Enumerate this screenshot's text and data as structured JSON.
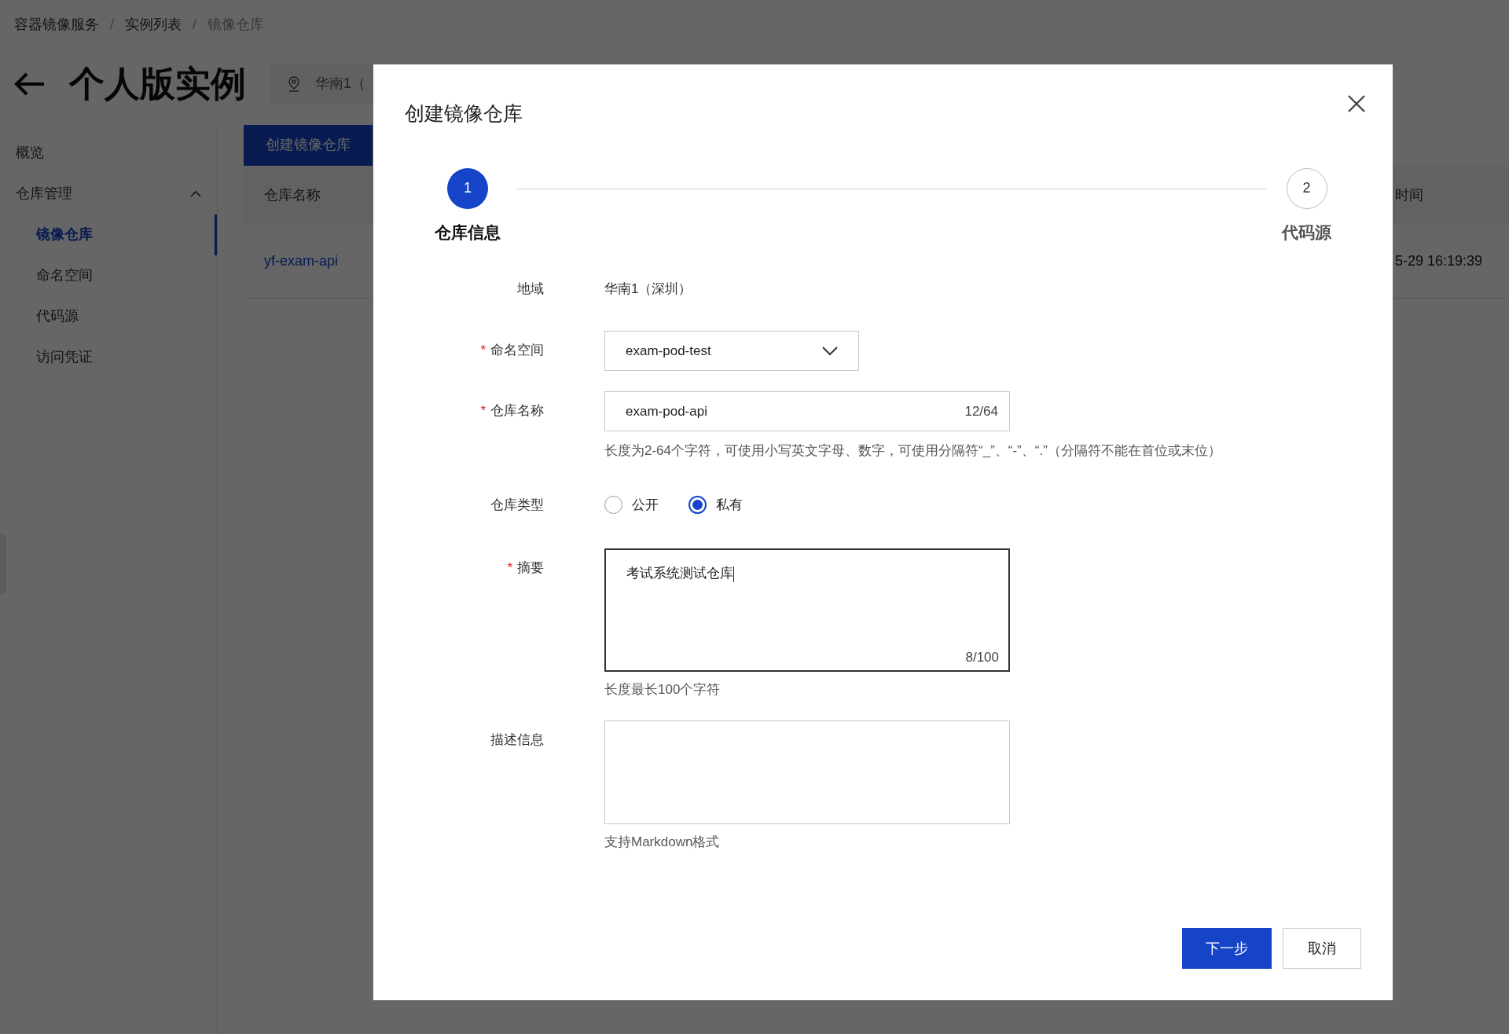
{
  "breadcrumb": [
    "容器镜像服务",
    "实例列表",
    "镜像仓库"
  ],
  "breadcrumb_separator": "/",
  "page": {
    "title": "个人版实例",
    "region": "华南1（"
  },
  "sidebar": {
    "items": [
      {
        "label": "概览"
      },
      {
        "label": "仓库管理",
        "expanded": true,
        "children": [
          {
            "label": "镜像仓库",
            "selected": true
          },
          {
            "label": "命名空间",
            "selected": false
          },
          {
            "label": "代码源",
            "selected": false
          },
          {
            "label": "访问凭证",
            "selected": false
          }
        ]
      }
    ]
  },
  "create_button": "创建镜像仓库",
  "table": {
    "columns": [
      "仓库名称",
      "时间"
    ],
    "rows": [
      [
        "yf-exam-api",
        "5-29 16:19:39"
      ]
    ]
  },
  "modal": {
    "title": "创建镜像仓库",
    "required_mark": "*",
    "steps": [
      {
        "number": "1",
        "label": "仓库信息",
        "selected": true
      },
      {
        "number": "2",
        "label": "代码源",
        "selected": false
      }
    ],
    "fields": [
      {
        "kind": "text",
        "label": "地域",
        "required": false,
        "value": "华南1（深圳）"
      },
      {
        "kind": "select",
        "label": "命名空间",
        "required": true,
        "value": "exam-pod-test"
      },
      {
        "kind": "input",
        "label": "仓库名称",
        "required": true,
        "value": "exam-pod-api",
        "counter": "12/64",
        "help": "长度为2-64个字符，可使用小写英文字母、数字，可使用分隔符“_”、“-”、“.”（分隔符不能在首位或末位）"
      },
      {
        "kind": "radio",
        "label": "仓库类型",
        "required": false,
        "options": [
          {
            "label": "公开",
            "selected": false
          },
          {
            "label": "私有",
            "selected": true
          }
        ]
      },
      {
        "kind": "textarea",
        "label": "摘要",
        "required": true,
        "focused": true,
        "value": "考试系统测试仓库",
        "counter": "8/100",
        "help": "长度最长100个字符"
      },
      {
        "kind": "textarea",
        "label": "描述信息",
        "required": false,
        "focused": false,
        "help": "支持Markdown格式"
      }
    ],
    "buttons": [
      {
        "label": "下一步",
        "primary": true
      },
      {
        "label": "取消",
        "primary": false
      }
    ]
  }
}
